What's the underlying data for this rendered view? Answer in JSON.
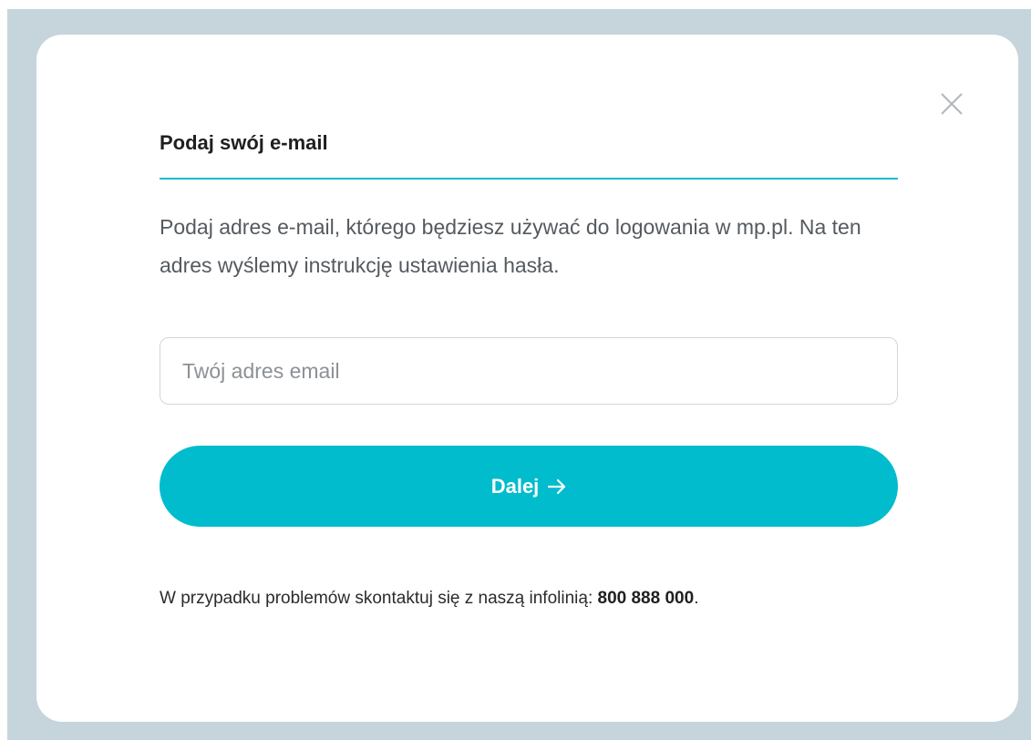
{
  "colors": {
    "backdrop": "#c5d5db",
    "modal_background": "#ffffff",
    "accent": "#00bccc",
    "title_rule": "#1bbccc",
    "text_dark": "#1f1f1f",
    "text_muted": "#555a5f"
  },
  "modal": {
    "close_icon": "close-icon",
    "title": "Podaj swój e-mail",
    "description": "Podaj adres e-mail, którego będziesz używać do logowania w mp.pl. Na ten adres wyślemy instrukcję ustawienia hasła.",
    "email_input": {
      "placeholder": "Twój adres email",
      "value": ""
    },
    "next_button": {
      "label": "Dalej",
      "icon": "arrow-right-icon"
    },
    "help": {
      "text": "W przypadku problemów skontaktuj się z naszą infolinią: ",
      "phone": "800 888 000",
      "suffix": "."
    }
  }
}
